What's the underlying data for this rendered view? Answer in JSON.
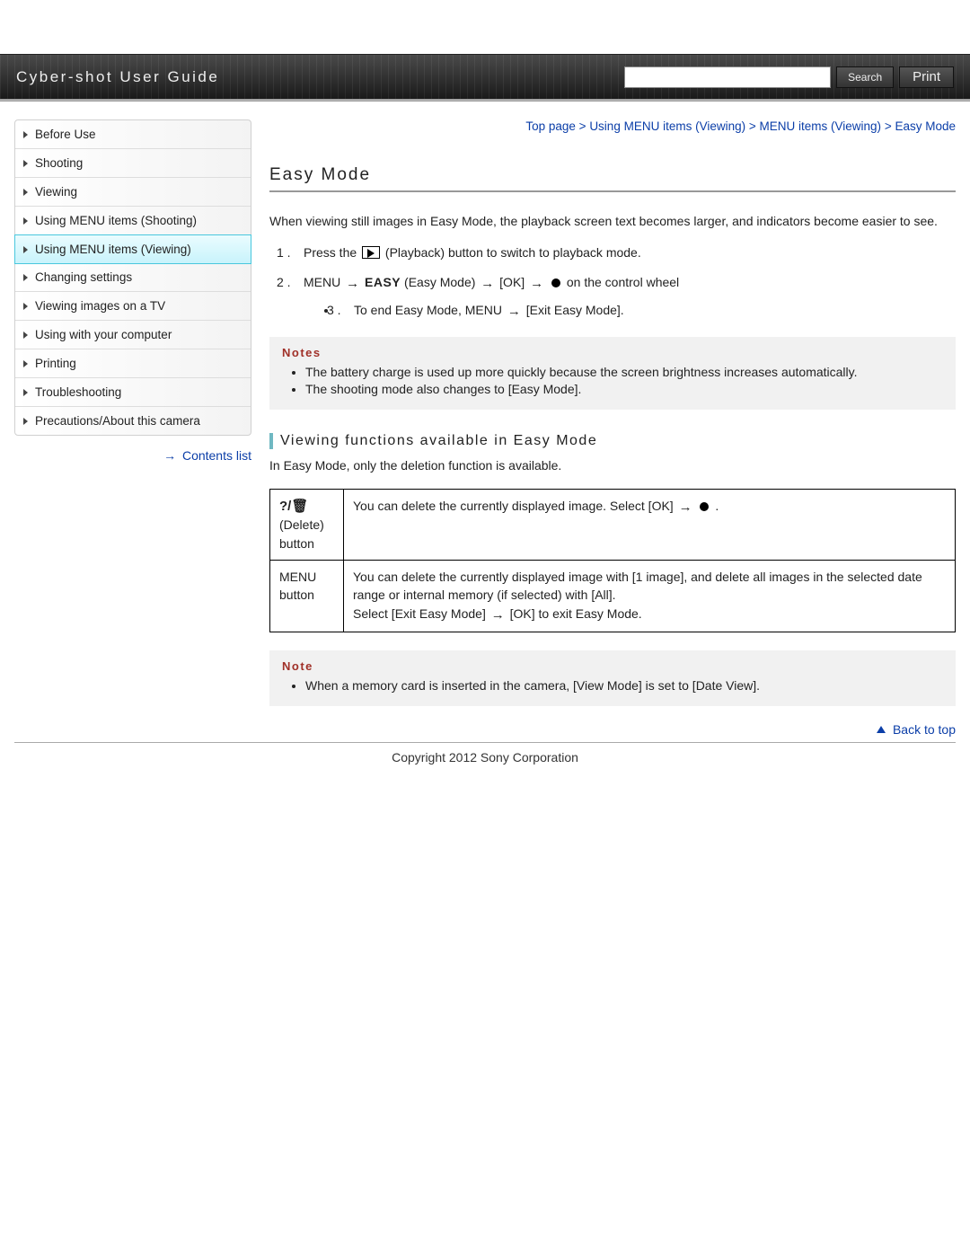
{
  "header": {
    "title": "Cyber-shot User Guide",
    "search_button": "Search",
    "print_button": "Print"
  },
  "sidebar": {
    "items": [
      {
        "label": "Before Use"
      },
      {
        "label": "Shooting"
      },
      {
        "label": "Viewing"
      },
      {
        "label": "Using MENU items (Shooting)"
      },
      {
        "label": "Using MENU items (Viewing)",
        "active": true
      },
      {
        "label": "Changing settings"
      },
      {
        "label": "Viewing images on a TV"
      },
      {
        "label": "Using with your computer"
      },
      {
        "label": "Printing"
      },
      {
        "label": "Troubleshooting"
      },
      {
        "label": "Precautions/About this camera"
      }
    ],
    "contents_list": "Contents list"
  },
  "breadcrumb": {
    "items": [
      "Top page",
      "Using MENU items (Viewing)",
      "MENU items (Viewing)",
      "Easy Mode"
    ],
    "sep": " > "
  },
  "article": {
    "title": "Easy Mode",
    "intro": "When viewing still images in Easy Mode, the playback screen text becomes larger, and indicators become easier to see.",
    "step1_a": "Press the ",
    "step1_b": " (Playback) button to switch to playback mode.",
    "step2_a": "MENU ",
    "step2_easy": "EASY",
    "step2_b": " (Easy Mode) ",
    "step2_c": " [OK] ",
    "step2_d": " on the control wheel",
    "step2_sub_a": "To end Easy Mode, MENU ",
    "step2_sub_b": " [Exit Easy Mode].",
    "notes1_title": "Notes",
    "notes1": [
      "The battery charge is used up more quickly because the screen brightness increases automatically.",
      "The shooting mode also changes to [Easy Mode]."
    ],
    "section_title": "Viewing functions available in Easy Mode",
    "section_p": "In Easy Mode, only the deletion function is available.",
    "table": {
      "row1_icon": "?/🗑",
      "row1_label": "(Delete) button",
      "row1_desc_a": "You can delete the currently displayed image. Select [OK] ",
      "row1_desc_b": " .",
      "row2_label": "MENU button",
      "row2_desc_a": "You can delete the currently displayed image with [1 image], and delete all images in the selected date range or internal memory (if selected) with [All].",
      "row2_desc_b": "Select [Exit Easy Mode] ",
      "row2_desc_c": " [OK] to exit Easy Mode."
    },
    "notes2_title": "Note",
    "notes2": [
      "When a memory card is inserted in the camera, [View Mode] is set to [Date View]."
    ],
    "back_to_top": "Back to top"
  },
  "footer": {
    "copyright": "Copyright 2012 Sony Corporation"
  }
}
